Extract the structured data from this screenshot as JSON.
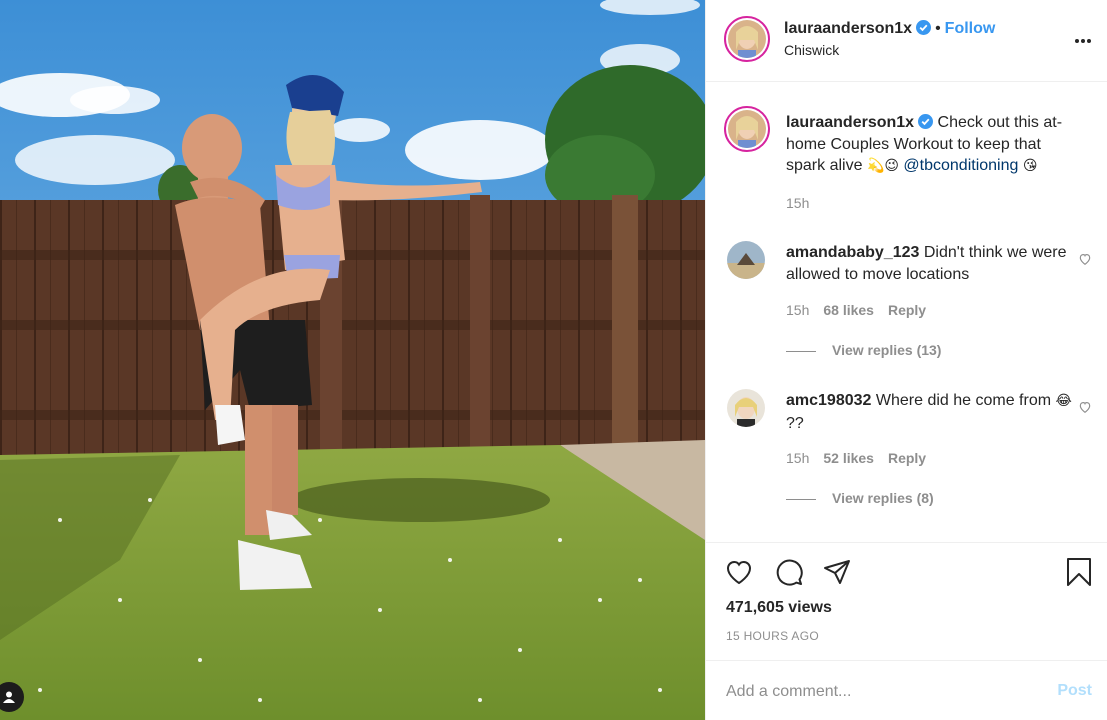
{
  "post": {
    "username": "lauraanderson1x",
    "verified": true,
    "follow_label": "Follow",
    "location": "Chiswick",
    "more_icon": "ellipsis-icon",
    "caption": {
      "text": "Check out this at-home Couples Workout to keep that spark alive",
      "emojis": "💫😉",
      "mention": "@tbconditioning",
      "emoji_end": "😘",
      "time": "15h"
    },
    "comments": [
      {
        "username": "amandababy_123",
        "text": "Didn't think we were allowed to move locations",
        "time": "15h",
        "likes": "68 likes",
        "reply_label": "Reply",
        "view_replies": "View replies (13)"
      },
      {
        "username": "amc198032",
        "text": "Where did he come from",
        "emoji": "😂",
        "text_after": "??",
        "time": "15h",
        "likes": "52 likes",
        "reply_label": "Reply",
        "view_replies": "View replies (8)"
      }
    ],
    "views": "471,605 views",
    "posted_ago": "15 HOURS AGO",
    "add_comment_placeholder": "Add a comment...",
    "post_label": "Post"
  },
  "icons": [
    "heart-icon",
    "comment-icon",
    "share-icon",
    "bookmark-icon",
    "user-tag-icon"
  ],
  "colors": {
    "link": "#3897f0",
    "mention": "#00376b",
    "muted": "#8e8e8e",
    "post_disabled": "#b2dffc",
    "verified": "#3897f0"
  }
}
